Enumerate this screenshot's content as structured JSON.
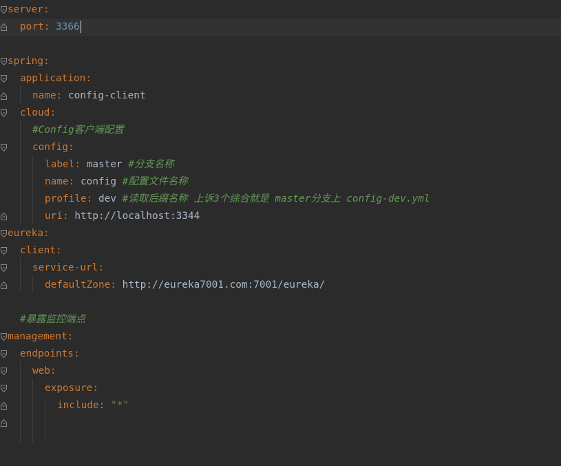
{
  "editor": {
    "language": "yaml",
    "colors": {
      "background": "#2b2b2b",
      "current_line": "#323232",
      "key": "#cc7832",
      "value": "#a9b7c6",
      "number": "#6897bb",
      "string": "#6a8759",
      "comment": "#629755"
    },
    "lines": [
      {
        "key": "server",
        "colon": ":"
      },
      {
        "key": "port",
        "colon": ":",
        "value": "3366"
      },
      {},
      {
        "key": "spring",
        "colon": ":"
      },
      {
        "key": "application",
        "colon": ":"
      },
      {
        "key": "name",
        "colon": ":",
        "value": "config-client"
      },
      {
        "key": "cloud",
        "colon": ":"
      },
      {
        "comment": "#Config客户端配置"
      },
      {
        "key": "config",
        "colon": ":"
      },
      {
        "key": "label",
        "colon": ":",
        "value": "master",
        "comment": "#分支名称"
      },
      {
        "key": "name",
        "colon": ":",
        "value": "config",
        "comment": "#配置文件名称"
      },
      {
        "key": "profile",
        "colon": ":",
        "value": "dev",
        "comment": "#读取后缀名称 上诉3个综合就是 master分支上 config-dev.yml"
      },
      {
        "key": "uri",
        "colon": ":",
        "value": "http://localhost:3344"
      },
      {
        "key": "eureka",
        "colon": ":"
      },
      {
        "key": "client",
        "colon": ":"
      },
      {
        "key": "service-url",
        "colon": ":"
      },
      {
        "key": "defaultZone",
        "colon": ":",
        "value": "http://eureka7001.com:7001/eureka/"
      },
      {},
      {
        "comment": "#暴露监控端点"
      },
      {
        "key": "management",
        "colon": ":"
      },
      {
        "key": "endpoints",
        "colon": ":"
      },
      {
        "key": "web",
        "colon": ":"
      },
      {
        "key": "exposure",
        "colon": ":"
      },
      {
        "key": "include",
        "colon": ":",
        "value": "\"*\""
      }
    ]
  }
}
